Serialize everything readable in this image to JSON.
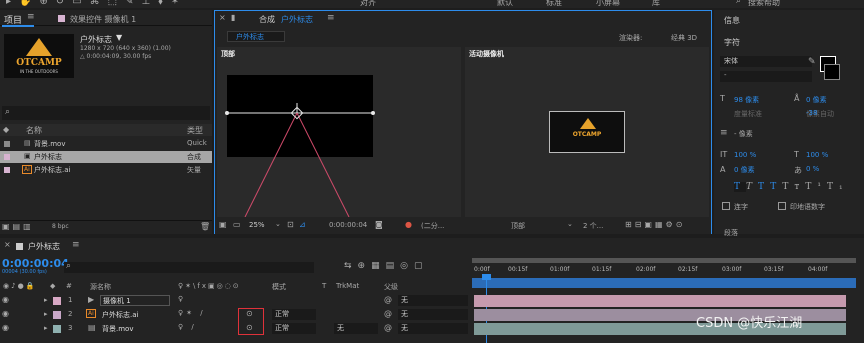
{
  "toolbar": {
    "workspaces": [
      "对齐",
      "默认",
      "标准",
      "小屏幕",
      "库"
    ],
    "search_placeholder": "搜索帮助"
  },
  "project_panel": {
    "tab_label": "项目",
    "effects_tab_label": "效果控件 摄像机 1",
    "preview_name": "户外标志",
    "preview_dims": "1280 x 720  (640 x 360) (1.00)",
    "preview_duration": "△ 0:00:04:09, 30.00 fps",
    "logo_text": "OTCAMP",
    "logo_sub": "IN THE OUTDOORS",
    "search_placeholder": "",
    "col_name": "名称",
    "col_type": "类型",
    "items": [
      {
        "icon": "video-icon",
        "name": "背景.mov",
        "type": "Quick",
        "color": "#888888"
      },
      {
        "icon": "comp-icon",
        "name": "户外标志",
        "type": "合成",
        "color": "#c7a8c7"
      },
      {
        "icon": "ai-icon",
        "name": "户外标志.ai",
        "type": "矢量",
        "color": "#c7a8c7"
      }
    ],
    "bpc": "8 bpc"
  },
  "composition_panel": {
    "tab_label": "合成",
    "comp_name": "户外标志",
    "breadcrumb": "户外标志",
    "renderer_label": "渲染器:",
    "renderer_value": "经典 3D",
    "view_left_label": "顶部",
    "view_right_label": "活动摄像机",
    "zoom": "25%",
    "timecode": "0:00:00:04",
    "resolution": "(二分...",
    "view_select": "顶部",
    "layout_select": "2 个..."
  },
  "info_panel": {
    "info_title": "信息",
    "char_title": "字符",
    "font_family": "宋体",
    "font_style": "-",
    "font_size": "98 像素",
    "leading": "0 像素",
    "leading_auto": "像素自动",
    "kerning_label": "度量标准",
    "tracking": "-38",
    "stroke": "- 像素",
    "vscale": "100 %",
    "hscale": "100 %",
    "baseline": "0 像素",
    "tsume": "0 %",
    "ligature": "连字",
    "hindi": "印地语数字",
    "bottom_label": "段落"
  },
  "timeline": {
    "tab_label": "户外标志",
    "timecode": "0:00:00:04",
    "fps": "00004 (30.00 fps)",
    "col_hash": "#",
    "col_name": "源名称",
    "col_mode": "模式",
    "col_t": "T",
    "col_trkmat": "TrkMat",
    "col_parent": "父级",
    "ruler": [
      "0:00f",
      "00:15f",
      "01:00f",
      "01:15f",
      "02:00f",
      "02:15f",
      "03:00f",
      "03:15f",
      "04:00f"
    ],
    "layers": [
      {
        "num": "1",
        "name": "摄像机 1",
        "color": "#d8a8c4",
        "icon": "camera-icon",
        "mode": "",
        "trkmat": "",
        "parent": "无",
        "bar_color": "#c69aae"
      },
      {
        "num": "2",
        "name": "户外标志.ai",
        "color": "#c8a8c8",
        "icon": "ai-icon",
        "mode": "正常",
        "trkmat": "",
        "parent": "无",
        "bar_color": "#9c8e9f"
      },
      {
        "num": "3",
        "name": "背景.mov",
        "color": "#8fb1b0",
        "icon": "video-icon",
        "mode": "正常",
        "trkmat": "无",
        "parent": "无",
        "bar_color": "#7f9a98"
      }
    ]
  },
  "watermark": "CSDN @快乐江湖"
}
